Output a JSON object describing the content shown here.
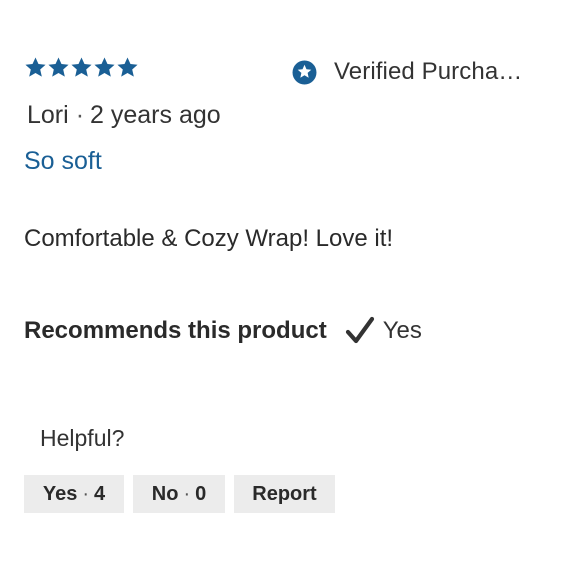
{
  "rating": {
    "value": 5,
    "max": 5,
    "color": "#1a5f95"
  },
  "verified": {
    "label": "Verified Purcha…",
    "icon": "verified-star-icon",
    "color": "#1a5f95"
  },
  "author": {
    "name": "Lori",
    "separator": "·",
    "posted": "2 years ago"
  },
  "review": {
    "headline": "So soft",
    "body": "Comfortable & Cozy Wrap! Love it!"
  },
  "recommendation": {
    "label": "Recommends this product",
    "icon": "checkmark-icon",
    "value": "Yes"
  },
  "helpful": {
    "label": "Helpful?",
    "yes_label": "Yes",
    "yes_count": "4",
    "no_label": "No",
    "no_count": "0",
    "separator": "·",
    "report_label": "Report"
  }
}
